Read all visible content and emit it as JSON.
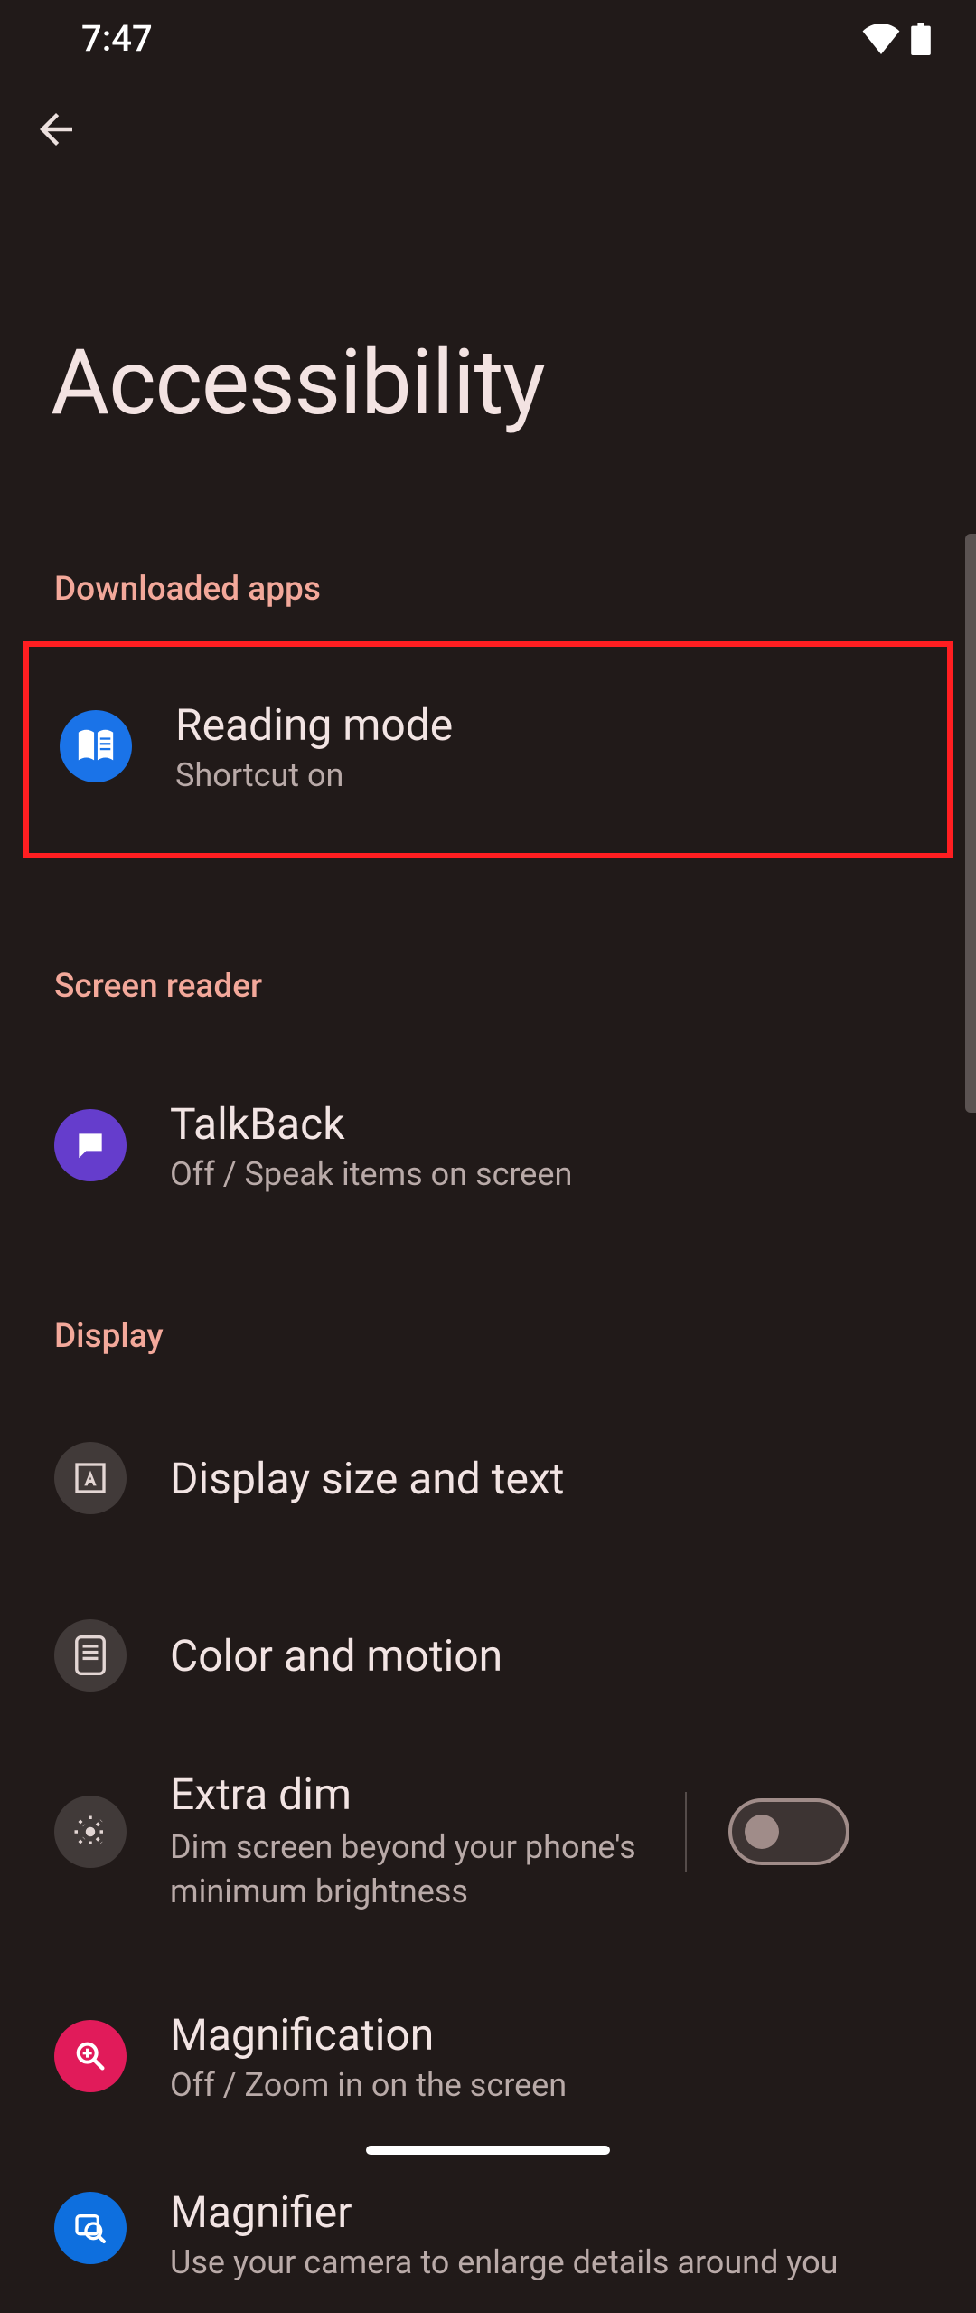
{
  "status_bar": {
    "time": "7:47"
  },
  "page": {
    "title": "Accessibility"
  },
  "sections": {
    "downloaded_apps": {
      "label": "Downloaded apps",
      "reading_mode": {
        "title": "Reading mode",
        "sub": "Shortcut on"
      }
    },
    "screen_reader": {
      "label": "Screen reader",
      "talkback": {
        "title": "TalkBack",
        "sub": "Off / Speak items on screen"
      }
    },
    "display": {
      "label": "Display",
      "display_size": {
        "title": "Display size and text"
      },
      "color_motion": {
        "title": "Color and motion"
      },
      "extra_dim": {
        "title": "Extra dim",
        "sub": "Dim screen beyond your phone's minimum brightness",
        "enabled": false
      },
      "magnification": {
        "title": "Magnification",
        "sub": "Off / Zoom in on the screen"
      },
      "magnifier": {
        "title": "Magnifier",
        "sub": "Use your camera to enlarge details around you"
      }
    }
  }
}
